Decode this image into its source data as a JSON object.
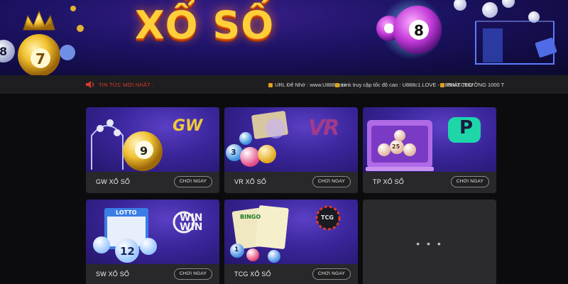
{
  "banner": {
    "title": "XỔ SỐ"
  },
  "ticker": {
    "news_label": "TIN TỨC MỚI NHẤT :",
    "messages": [
      "URL Để Nhớ : www.U888.com",
      "Link truy cập tốc độ cao : U888c1.LOVE - U888c3.CEO",
      "PHÁT THƯỞNG 1000 T"
    ]
  },
  "cards": [
    {
      "name": "GW XỔ SỐ",
      "play_label": "CHƠI NGAY",
      "logo": "GW",
      "ball_number": "9"
    },
    {
      "name": "VR XỔ SỐ",
      "play_label": "CHƠI NGAY",
      "logo": "VR",
      "ball_number": "3"
    },
    {
      "name": "TP XỔ SỐ",
      "play_label": "CHƠI NGAY",
      "logo": "P",
      "ball_number": "25"
    },
    {
      "name": "SW XỔ SỐ",
      "play_label": "CHƠI NGAY",
      "logo": "WIN WIN",
      "ball_number": "12",
      "art_label": "LOTTO"
    },
    {
      "name": "TCG XỔ SỐ",
      "play_label": "CHƠI NGAY",
      "logo": "TCG",
      "ball_number": "1",
      "art_label": "BINGO"
    },
    {
      "name": "",
      "placeholder": "• • •"
    }
  ],
  "colors": {
    "accent_gold": "#ffcf3a",
    "news_red": "#d83b2e",
    "card_bg": "#28282b",
    "art_purple": "#3a259a"
  }
}
